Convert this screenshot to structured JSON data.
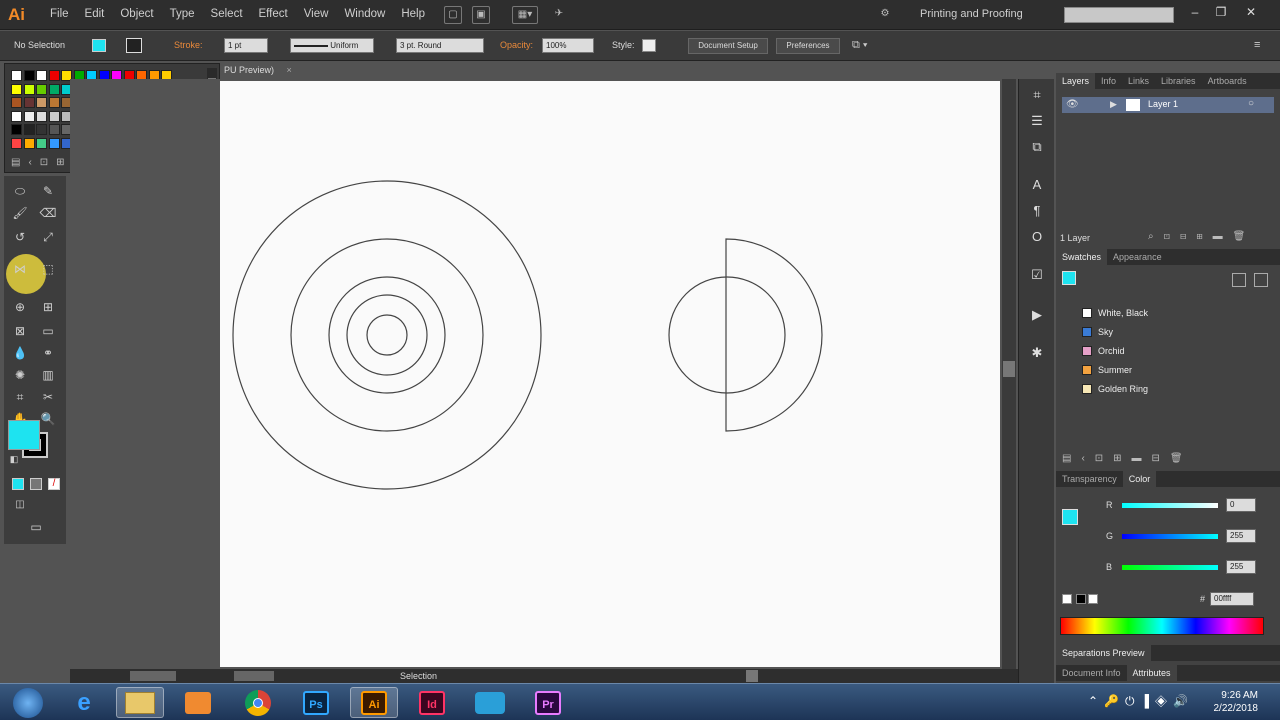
{
  "app": {
    "logo": "Ai",
    "workspace": "Printing and Proofing",
    "search_placeholder": ""
  },
  "menu": [
    "File",
    "Edit",
    "Object",
    "Type",
    "Select",
    "Effect",
    "View",
    "Window",
    "Help"
  ],
  "control": {
    "selection": "No Selection",
    "stroke_label": "Stroke:",
    "stroke_weight": "1 pt",
    "profile": "Uniform",
    "brush": "3 pt. Round",
    "opacity_label": "Opacity:",
    "opacity": "100%",
    "style_label": "Style:",
    "doc_setup": "Document Setup",
    "preferences": "Preferences"
  },
  "doc_tab": "PU Preview)",
  "status": "Selection",
  "panels": {
    "layers_tabs": [
      "Layers",
      "Info",
      "Links",
      "Libraries",
      "Artboards"
    ],
    "layer_name": "Layer 1",
    "layer_count": "1 Layer",
    "swatch_tabs": [
      "Swatches",
      "Appearance"
    ],
    "swatch_groups": [
      {
        "name": "White, Black",
        "color": "#ffffff"
      },
      {
        "name": "Sky",
        "color": "#3a7bd5"
      },
      {
        "name": "Orchid",
        "color": "#e6a0c8"
      },
      {
        "name": "Summer",
        "color": "#f4a340"
      },
      {
        "name": "Golden Ring",
        "color": "#f7e7b5"
      }
    ],
    "color_tabs": [
      "Transparency",
      "Color"
    ],
    "rgb": {
      "r": "0",
      "g": "255",
      "b": "255"
    },
    "hex": "00ffff",
    "bottom_tabs": [
      "Separations Preview"
    ],
    "bottom_tabs2": [
      "Document Info",
      "Attributes"
    ]
  },
  "colors": {
    "fill": "#1ee3f0",
    "accent_orange": "#f28a28"
  },
  "taskbar": {
    "apps": [
      "start",
      "ie",
      "explorer",
      "media",
      "chrome",
      "Ps",
      "Ai",
      "Id",
      "camera",
      "Pr"
    ],
    "time": "9:26 AM",
    "date": "2/22/2018"
  }
}
